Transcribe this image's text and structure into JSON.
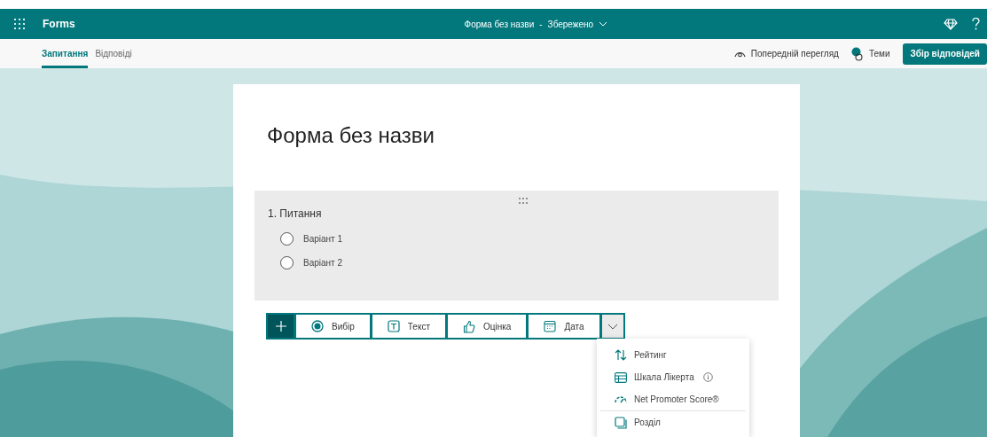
{
  "header": {
    "app": "Forms",
    "title": "Форма без назви",
    "separator": "-",
    "status": "Збережено"
  },
  "tabs": [
    {
      "label": "Запитання",
      "selected": true
    },
    {
      "label": "Відповіді",
      "selected": false
    }
  ],
  "actions": {
    "preview": "Попередній перегляд",
    "themes": "Теми",
    "collect": "Збір відповідей"
  },
  "form": {
    "title": "Форма без назви",
    "question": {
      "title": "1. Питання",
      "options": [
        {
          "label": "Варіант 1",
          "selected": false
        },
        {
          "label": "Варіант 2",
          "selected": false
        }
      ]
    },
    "toolbar": [
      {
        "kind": "choice",
        "label": "Вибір"
      },
      {
        "kind": "text",
        "label": "Текст"
      },
      {
        "kind": "rating",
        "label": "Оцінка"
      },
      {
        "kind": "date",
        "label": "Дата"
      }
    ],
    "more_menu": {
      "expanded": true,
      "items": [
        {
          "kind": "ranking",
          "label": "Рейтинг",
          "info": false
        },
        {
          "kind": "likert",
          "label": "Шкала Лікерта",
          "info": true
        },
        {
          "kind": "nps",
          "label": "Net Promoter Score®",
          "info": false
        },
        {
          "kind": "section",
          "label": "Розділ",
          "info": false
        }
      ]
    }
  }
}
